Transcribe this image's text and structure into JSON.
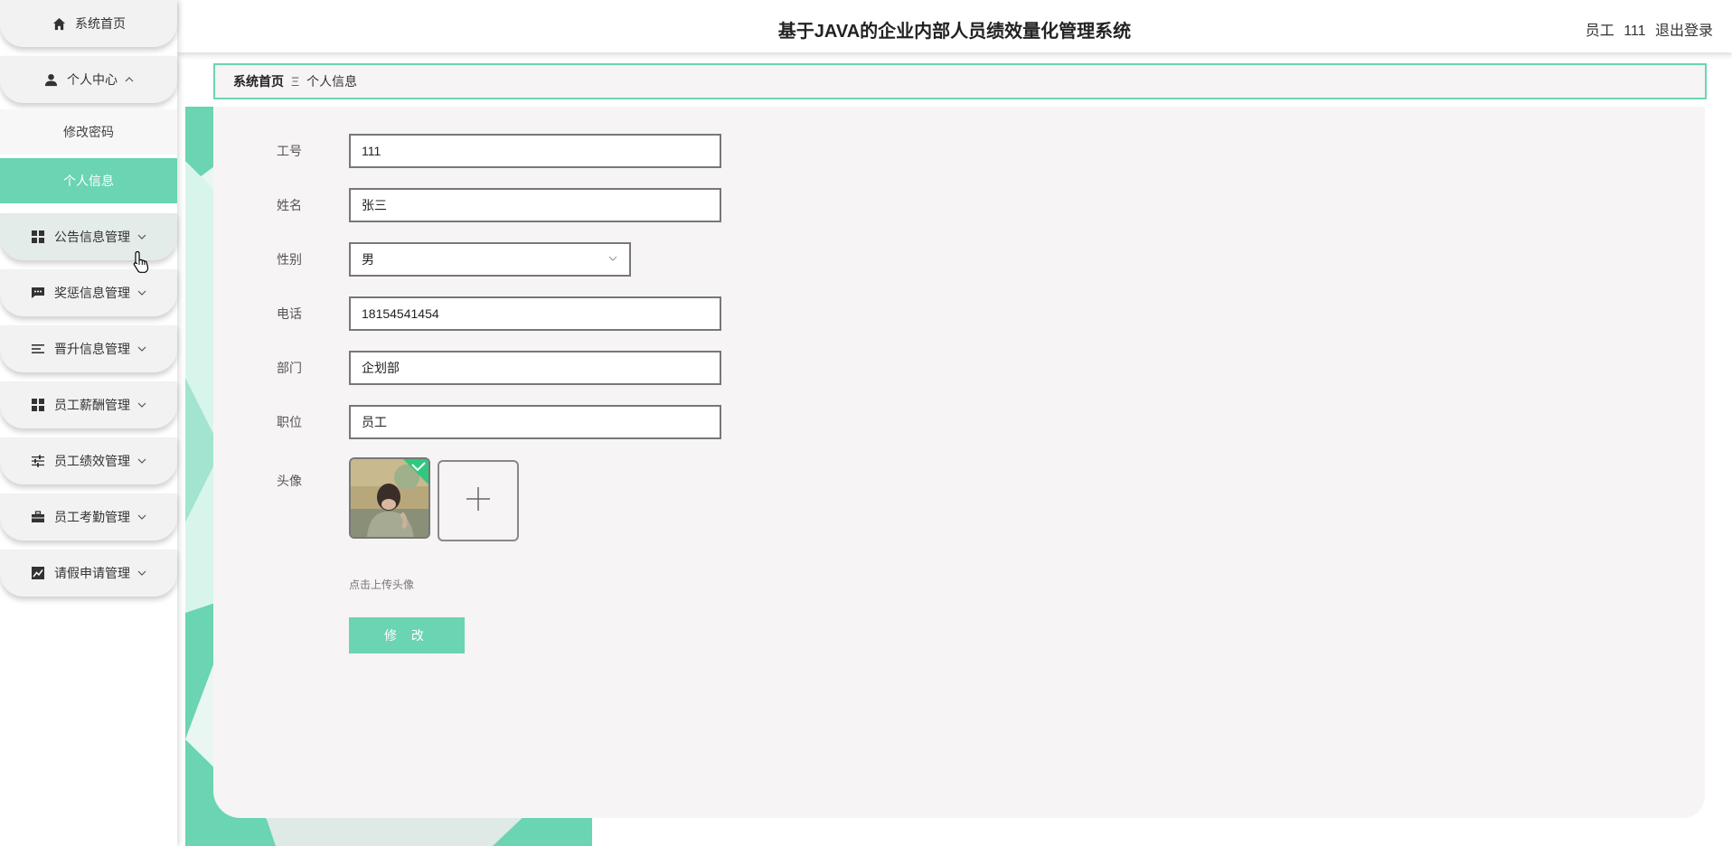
{
  "app": {
    "title": "基于JAVA的企业内部人员绩效量化管理系统",
    "user_role": "员工",
    "user_name": "111",
    "logout_label": "退出登录"
  },
  "sidebar": {
    "home": {
      "label": "系统首页",
      "icon": "home-icon"
    },
    "personal": {
      "label": "个人中心",
      "icon": "person-icon",
      "expanded": true,
      "children": [
        {
          "label": "修改密码",
          "active": false
        },
        {
          "label": "个人信息",
          "active": true
        }
      ]
    },
    "items": [
      {
        "label": "公告信息管理",
        "icon": "grid-icon"
      },
      {
        "label": "奖惩信息管理",
        "icon": "chat-icon"
      },
      {
        "label": "晋升信息管理",
        "icon": "list-icon"
      },
      {
        "label": "员工薪酬管理",
        "icon": "grid-icon"
      },
      {
        "label": "员工绩效管理",
        "icon": "sliders-icon"
      },
      {
        "label": "员工考勤管理",
        "icon": "briefcase-icon"
      },
      {
        "label": "请假申请管理",
        "icon": "chart-icon"
      }
    ]
  },
  "breadcrumb": {
    "home": "系统首页",
    "separator": "Ξ",
    "current": "个人信息"
  },
  "form": {
    "employee_no": {
      "label": "工号",
      "value": "111"
    },
    "name": {
      "label": "姓名",
      "value": "张三"
    },
    "gender": {
      "label": "性别",
      "value": "男"
    },
    "phone": {
      "label": "电话",
      "value": "18154541454"
    },
    "department": {
      "label": "部门",
      "value": "企划部"
    },
    "position": {
      "label": "职位",
      "value": "员工"
    },
    "avatar": {
      "label": "头像",
      "upload_tip": "点击上传头像"
    },
    "submit_label": "修 改"
  },
  "colors": {
    "accent": "#6bd4b2",
    "panel": "#f6f4f5"
  }
}
